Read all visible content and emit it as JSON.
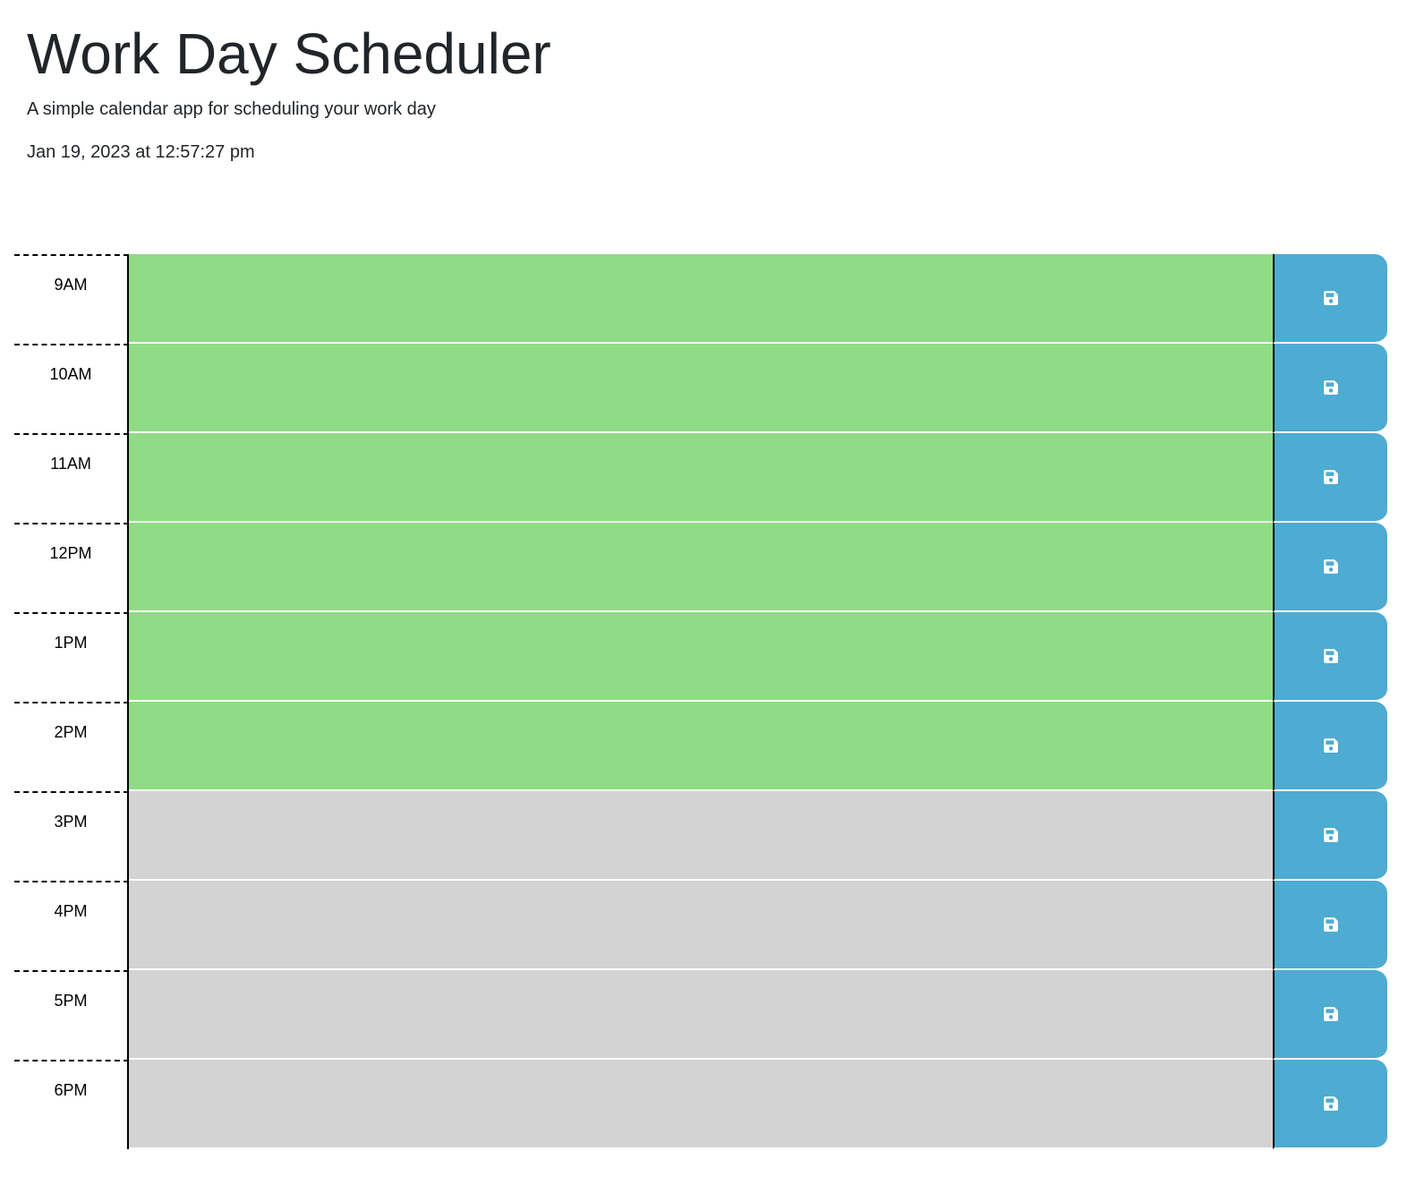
{
  "header": {
    "title": "Work Day Scheduler",
    "subtitle": "A simple calendar app for scheduling your work day",
    "datetime": "Jan 19, 2023 at 12:57:27 pm"
  },
  "colors": {
    "present_future": "#90db85",
    "past": "#d3d3d3",
    "save_button": "#4eabd2",
    "save_icon": "#ffffff"
  },
  "time_blocks": [
    {
      "hour": "9AM",
      "text": "",
      "status": "present-future",
      "save_icon": "floppy-disk-icon"
    },
    {
      "hour": "10AM",
      "text": "",
      "status": "present-future",
      "save_icon": "floppy-disk-icon"
    },
    {
      "hour": "11AM",
      "text": "",
      "status": "present-future",
      "save_icon": "floppy-disk-icon"
    },
    {
      "hour": "12PM",
      "text": "",
      "status": "present-future",
      "save_icon": "floppy-disk-icon"
    },
    {
      "hour": "1PM",
      "text": "",
      "status": "present-future",
      "save_icon": "floppy-disk-icon"
    },
    {
      "hour": "2PM",
      "text": "",
      "status": "present-future",
      "save_icon": "floppy-disk-icon"
    },
    {
      "hour": "3PM",
      "text": "",
      "status": "past",
      "save_icon": "floppy-disk-icon"
    },
    {
      "hour": "4PM",
      "text": "",
      "status": "past",
      "save_icon": "floppy-disk-icon"
    },
    {
      "hour": "5PM",
      "text": "",
      "status": "past",
      "save_icon": "floppy-disk-icon"
    },
    {
      "hour": "6PM",
      "text": "",
      "status": "past",
      "save_icon": "floppy-disk-icon"
    }
  ]
}
